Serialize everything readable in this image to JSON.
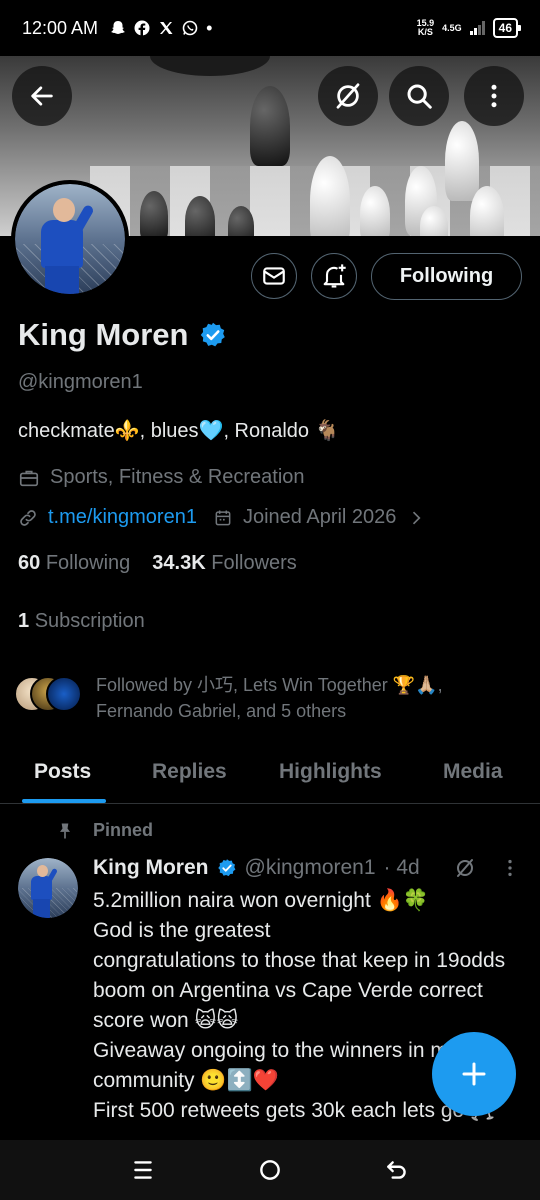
{
  "status": {
    "time": "12:00 AM",
    "speed_value": "15.9",
    "speed_unit": "K/S",
    "network": "4.5G",
    "battery": "46"
  },
  "profile": {
    "name": "King Moren",
    "handle": "@kingmoren1",
    "bio": "checkmate⚜️, blues🩵, Ronaldo 🐐",
    "category": "Sports, Fitness & Recreation",
    "link": "t.me/kingmoren1",
    "joined": "Joined April 2026",
    "following_count": "60",
    "following_label": "Following",
    "followers_count": "34.3K",
    "followers_label": "Followers",
    "subscription_count": "1",
    "subscription_label": "Subscription",
    "followed_by": "Followed by 小巧, Lets Win Together 🏆🙏🏼, Fernando Gabriel, and 5 others"
  },
  "actions": {
    "following_label": "Following"
  },
  "tabs": [
    {
      "label": "Posts"
    },
    {
      "label": "Replies"
    },
    {
      "label": "Highlights"
    },
    {
      "label": "Media"
    }
  ],
  "tweet": {
    "pinned_label": "Pinned",
    "author": "King Moren",
    "handle": "@kingmoren1",
    "time": "· 4d",
    "text": "5.2million naira won overnight 🔥🍀\nGod is the greatest\ncongratulations to those that keep in 19odds boom on Argentina vs Cape Verde correct score won 🙀🙀\nGiveaway ongoing to the winners in my community 🙂↕️❤️\nFirst 500 retweets gets 30k each lets go 🥂"
  },
  "colors": {
    "accent": "#1d9bf0",
    "verified": "#1d9bf0",
    "muted": "#71767b",
    "background": "#000000"
  }
}
